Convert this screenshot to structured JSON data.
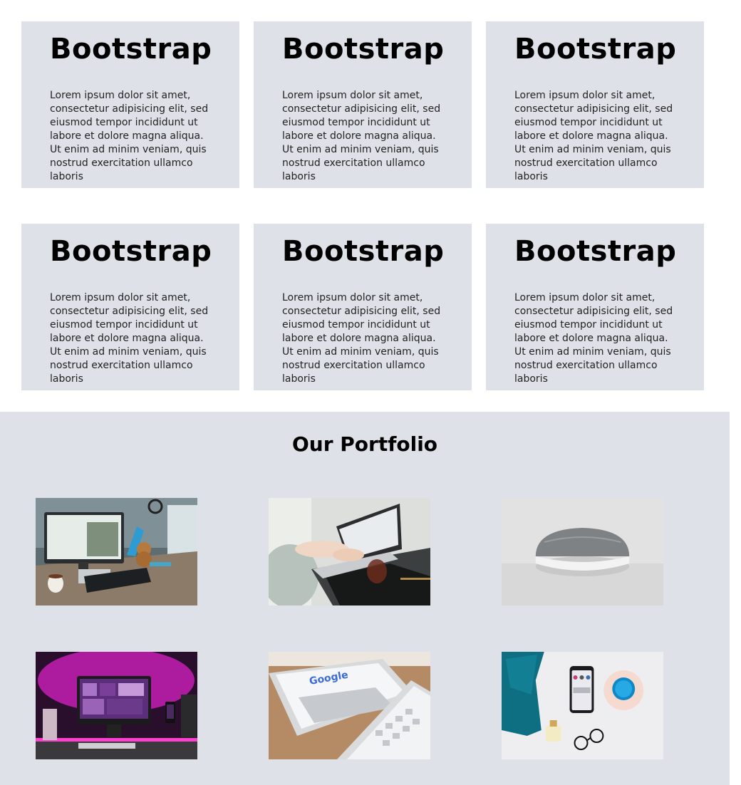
{
  "cards": [
    {
      "title": "Bootstrap",
      "body": "Lorem ipsum dolor sit amet, consectetur adipisicing elit, sed eiusmod tempor incididunt ut labore et dolore magna aliqua. Ut enim ad minim veniam, quis nostrud exercitation ullamco laboris"
    },
    {
      "title": "Bootstrap",
      "body": "Lorem ipsum dolor sit amet, consectetur adipisicing elit, sed eiusmod tempor incididunt ut labore et dolore magna aliqua. Ut enim ad minim veniam, quis nostrud exercitation ullamco laboris"
    },
    {
      "title": "Bootstrap",
      "body": "Lorem ipsum dolor sit amet, consectetur adipisicing elit, sed eiusmod tempor incididunt ut labore et dolore magna aliqua. Ut enim ad minim veniam, quis nostrud exercitation ullamco laboris"
    },
    {
      "title": "Bootstrap",
      "body": "Lorem ipsum dolor sit amet, consectetur adipisicing elit, sed eiusmod tempor incididunt ut labore et dolore magna aliqua. Ut enim ad minim veniam, quis nostrud exercitation ullamco laboris"
    },
    {
      "title": "Bootstrap",
      "body": "Lorem ipsum dolor sit amet, consectetur adipisicing elit, sed eiusmod tempor incididunt ut labore et dolore magna aliqua. Ut enim ad minim veniam, quis nostrud exercitation ullamco laboris"
    },
    {
      "title": "Bootstrap",
      "body": "Lorem ipsum dolor sit amet, consectetur adipisicing elit, sed eiusmod tempor incididunt ut labore et dolore magna aliqua. Ut enim ad minim veniam, quis nostrud exercitation ullamco laboris"
    }
  ],
  "portfolio": {
    "heading": "Our Portfolio",
    "items": [
      {
        "icon": "desk-computer-photo"
      },
      {
        "icon": "laptop-typing-photo"
      },
      {
        "icon": "smart-speaker-photo"
      },
      {
        "icon": "pink-desk-setup-photo"
      },
      {
        "icon": "tablet-keyboard-photo"
      },
      {
        "icon": "phone-flatlay-photo"
      }
    ]
  },
  "colors": {
    "panel": "#dee1e7",
    "page": "#ffffff",
    "text": "#000000"
  }
}
